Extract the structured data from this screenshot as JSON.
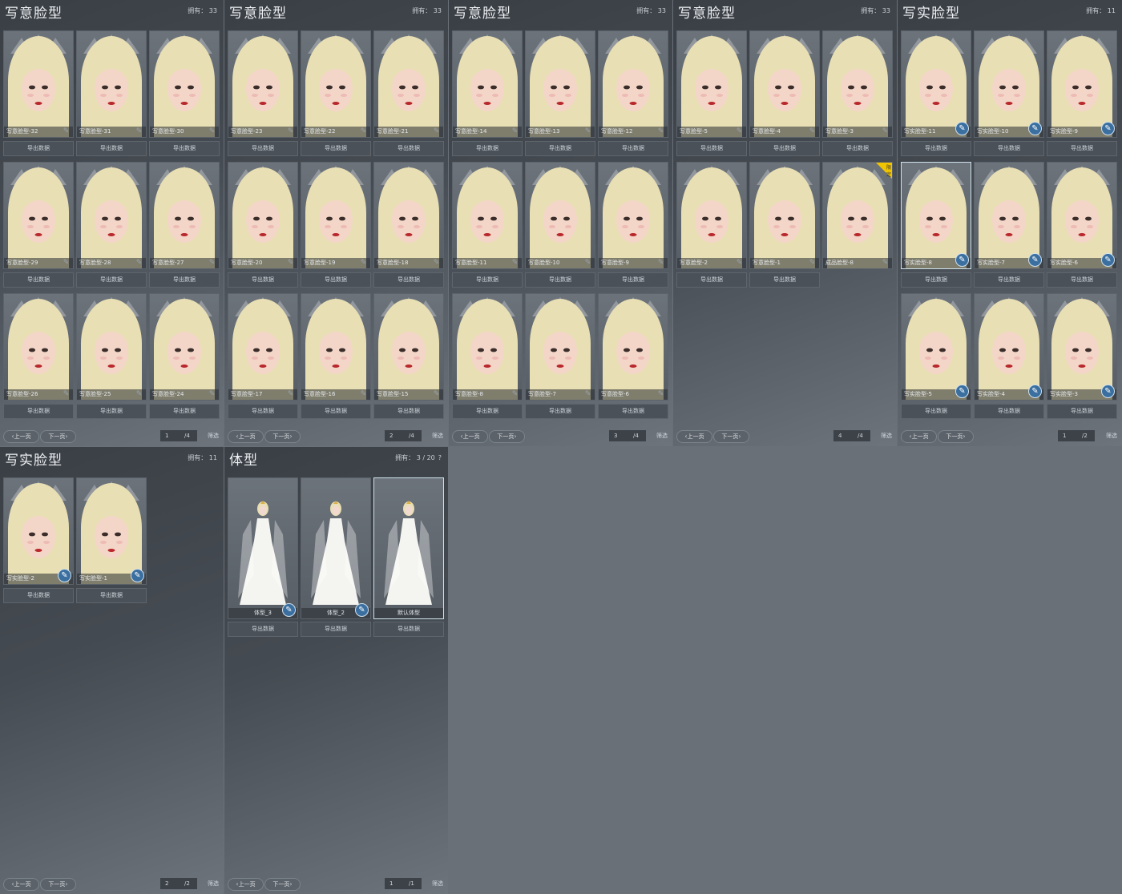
{
  "panels": [
    {
      "title": "写意脸型",
      "owned": "拥有： 33",
      "prev": "上一页",
      "next": "下一页",
      "page": "1",
      "total": "/4",
      "filter": "筛选",
      "cards": [
        {
          "label": "写意脸型-32"
        },
        {
          "label": "写意脸型-31"
        },
        {
          "label": "写意脸型-30"
        },
        {
          "label": "写意脸型-29"
        },
        {
          "label": "写意脸型-28"
        },
        {
          "label": "写意脸型-27"
        },
        {
          "label": "写意脸型-26"
        },
        {
          "label": "写意脸型-25"
        },
        {
          "label": "写意脸型-24"
        }
      ],
      "btn": "导出数据"
    },
    {
      "title": "写意脸型",
      "owned": "拥有： 33",
      "prev": "上一页",
      "next": "下一页",
      "page": "2",
      "total": "/4",
      "filter": "筛选",
      "cards": [
        {
          "label": "写意脸型-23"
        },
        {
          "label": "写意脸型-22"
        },
        {
          "label": "写意脸型-21"
        },
        {
          "label": "写意脸型-20"
        },
        {
          "label": "写意脸型-19"
        },
        {
          "label": "写意脸型-18"
        },
        {
          "label": "写意脸型-17"
        },
        {
          "label": "写意脸型-16"
        },
        {
          "label": "写意脸型-15"
        }
      ],
      "btn": "导出数据"
    },
    {
      "title": "写意脸型",
      "owned": "拥有： 33",
      "prev": "上一页",
      "next": "下一页",
      "page": "3",
      "total": "/4",
      "filter": "筛选",
      "cards": [
        {
          "label": "写意脸型-14"
        },
        {
          "label": "写意脸型-13"
        },
        {
          "label": "写意脸型-12"
        },
        {
          "label": "写意脸型-11"
        },
        {
          "label": "写意脸型-10"
        },
        {
          "label": "写意脸型-9"
        },
        {
          "label": "写意脸型-8"
        },
        {
          "label": "写意脸型-7"
        },
        {
          "label": "写意脸型-6"
        }
      ],
      "btn": "导出数据"
    },
    {
      "title": "写意脸型",
      "owned": "拥有： 33",
      "prev": "上一页",
      "next": "下一页",
      "page": "4",
      "total": "/4",
      "filter": "筛选",
      "cards": [
        {
          "label": "写意脸型-5"
        },
        {
          "label": "写意脸型-4"
        },
        {
          "label": "写意脸型-3"
        },
        {
          "label": "写意脸型-2"
        },
        {
          "label": "写意脸型-1"
        },
        {
          "label": "成品脸型-8",
          "badge": "限定"
        }
      ],
      "btn": "导出数据"
    },
    {
      "title": "写实脸型",
      "owned": "拥有： 11",
      "prev": "上一页",
      "next": "下一页",
      "page": "1",
      "total": "/2",
      "filter": "筛选",
      "cards": [
        {
          "label": "写实脸型-11"
        },
        {
          "label": "写实脸型-10"
        },
        {
          "label": "写实脸型-9"
        },
        {
          "label": "写实脸型-8"
        },
        {
          "label": "写实脸型-7"
        },
        {
          "label": "写实脸型-6"
        },
        {
          "label": "写实脸型-5"
        },
        {
          "label": "写实脸型-4"
        },
        {
          "label": "写实脸型-3"
        }
      ],
      "btn": "导出数据"
    },
    {
      "title": "写实脸型",
      "owned": "拥有： 11",
      "prev": "上一页",
      "next": "下一页",
      "page": "2",
      "total": "/2",
      "filter": "筛选",
      "cards": [
        {
          "label": "写实脸型-2"
        },
        {
          "label": "写实脸型-1"
        }
      ],
      "btn": "导出数据"
    },
    {
      "title": "体型",
      "owned": "拥有： 3 / 20",
      "help": "?",
      "prev": "上一页",
      "next": "下一页",
      "page": "1",
      "total": "/1",
      "filter": "筛选",
      "cards": [
        {
          "label": "体型_3"
        },
        {
          "label": "体型_2"
        },
        {
          "label": "默认体型"
        }
      ],
      "btn": "导出数据"
    }
  ],
  "colors": {
    "page_bg": "#6a7078",
    "hair": "#e9dfb4",
    "dress": "#f4f4f0",
    "pen_blue": "#3a6fa0",
    "badge": "#f1c400"
  },
  "icons": {
    "edit": "pen-icon",
    "prev": "chevron-left-icon",
    "next": "chevron-right-icon",
    "limited": "limited-badge-icon"
  }
}
